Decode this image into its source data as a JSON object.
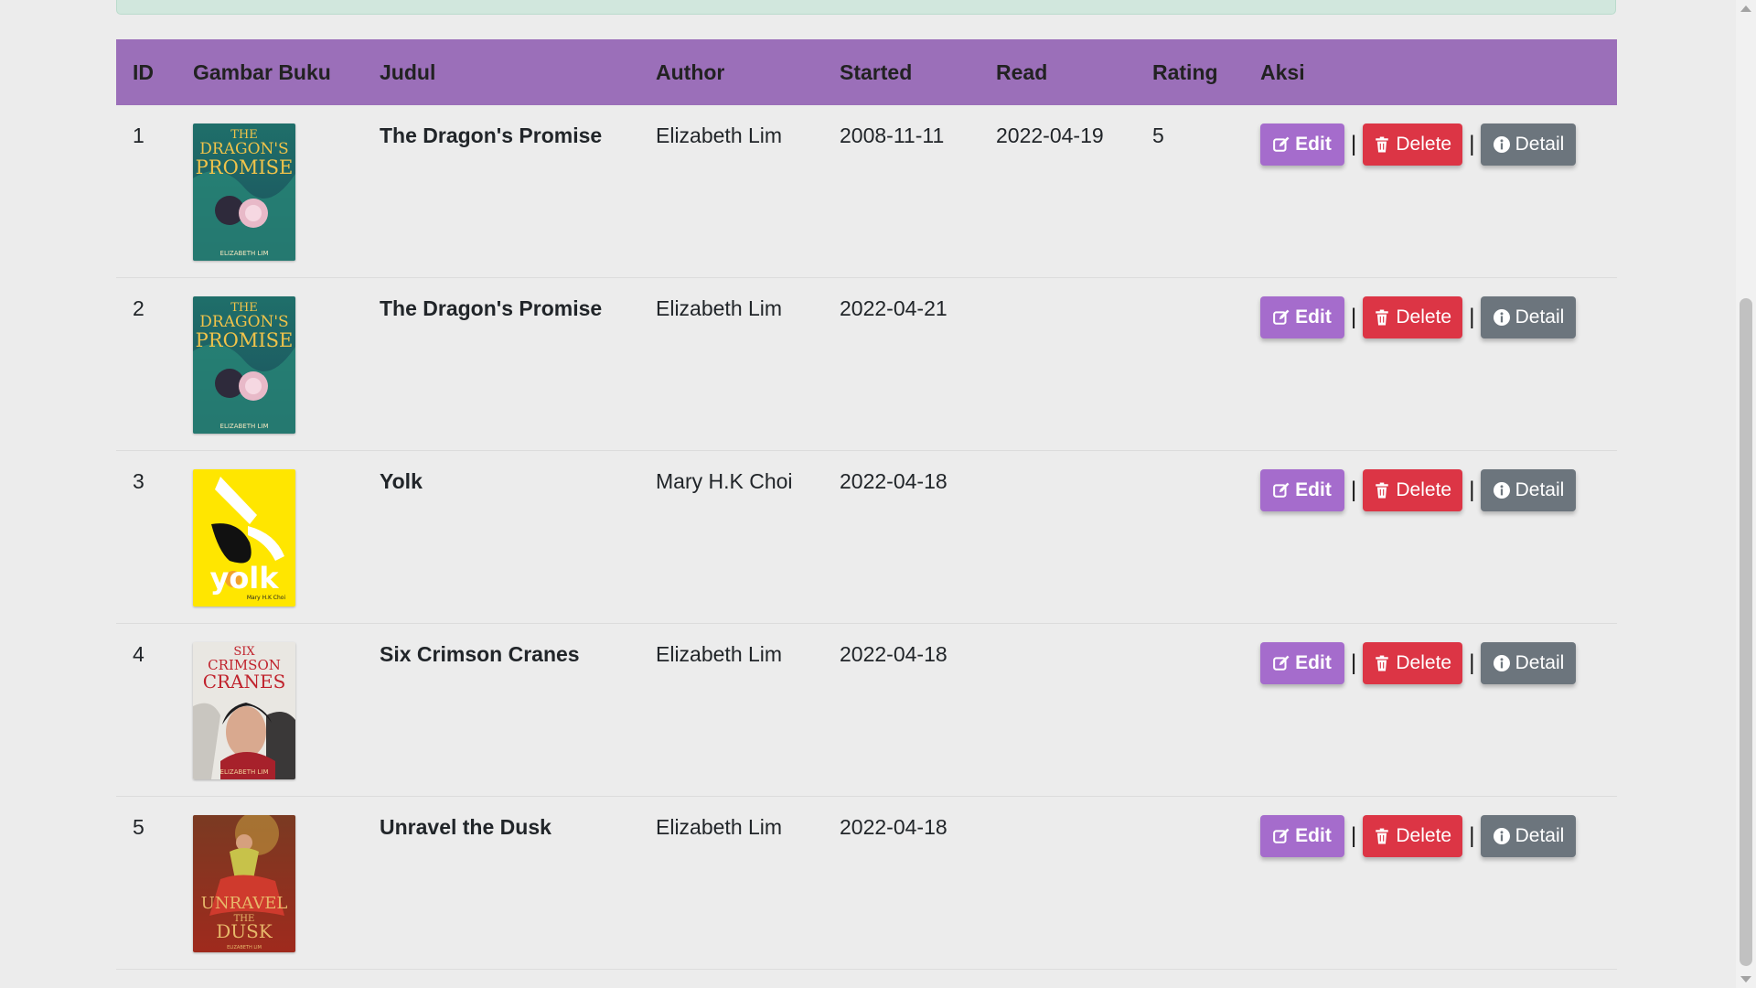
{
  "table": {
    "headers": [
      "ID",
      "Gambar Buku",
      "Judul",
      "Author",
      "Started",
      "Read",
      "Rating",
      "Aksi"
    ],
    "rows": [
      {
        "id": "1",
        "cover": "dragons-promise",
        "judul": "The Dragon's Promise",
        "author": "Elizabeth Lim",
        "started": "2008-11-11",
        "read": "2022-04-19",
        "rating": "5"
      },
      {
        "id": "2",
        "cover": "dragons-promise",
        "judul": "The Dragon's Promise",
        "author": "Elizabeth Lim",
        "started": "2022-04-21",
        "read": "",
        "rating": ""
      },
      {
        "id": "3",
        "cover": "yolk",
        "judul": "Yolk",
        "author": "Mary H.K Choi",
        "started": "2022-04-18",
        "read": "",
        "rating": ""
      },
      {
        "id": "4",
        "cover": "six-crimson-cranes",
        "judul": "Six Crimson Cranes",
        "author": "Elizabeth Lim",
        "started": "2022-04-18",
        "read": "",
        "rating": ""
      },
      {
        "id": "5",
        "cover": "unravel-the-dusk",
        "judul": "Unravel the Dusk",
        "author": "Elizabeth Lim",
        "started": "2022-04-18",
        "read": "",
        "rating": ""
      }
    ]
  },
  "actions": {
    "edit_label": "Edit",
    "delete_label": "Delete",
    "detail_label": "Detail",
    "separator": "|"
  },
  "covers": {
    "dragons-promise": {
      "line1": "THE",
      "line2": "DRAGON'S",
      "line3": "PROMISE",
      "author": "ELIZABETH LIM"
    },
    "yolk": {
      "title": "yolk",
      "author": "Mary H.K Choi"
    },
    "six-crimson-cranes": {
      "line1": "SIX",
      "line2": "CRIMSON",
      "line3": "CRANES",
      "author": "ELIZABETH LIM"
    },
    "unravel-the-dusk": {
      "line1": "UNRAVEL",
      "line2": "THE",
      "line3": "DUSK",
      "author": "ELIZABETH LIM"
    }
  },
  "colors": {
    "header_bg": "#9b6fb9",
    "edit": "#a56ccc",
    "delete": "#dc3545",
    "detail": "#6c757d",
    "alert": "#d1e7dd"
  },
  "icons": {
    "edit": "pencil-square-icon",
    "delete": "trash-icon",
    "detail": "info-circle-icon"
  }
}
